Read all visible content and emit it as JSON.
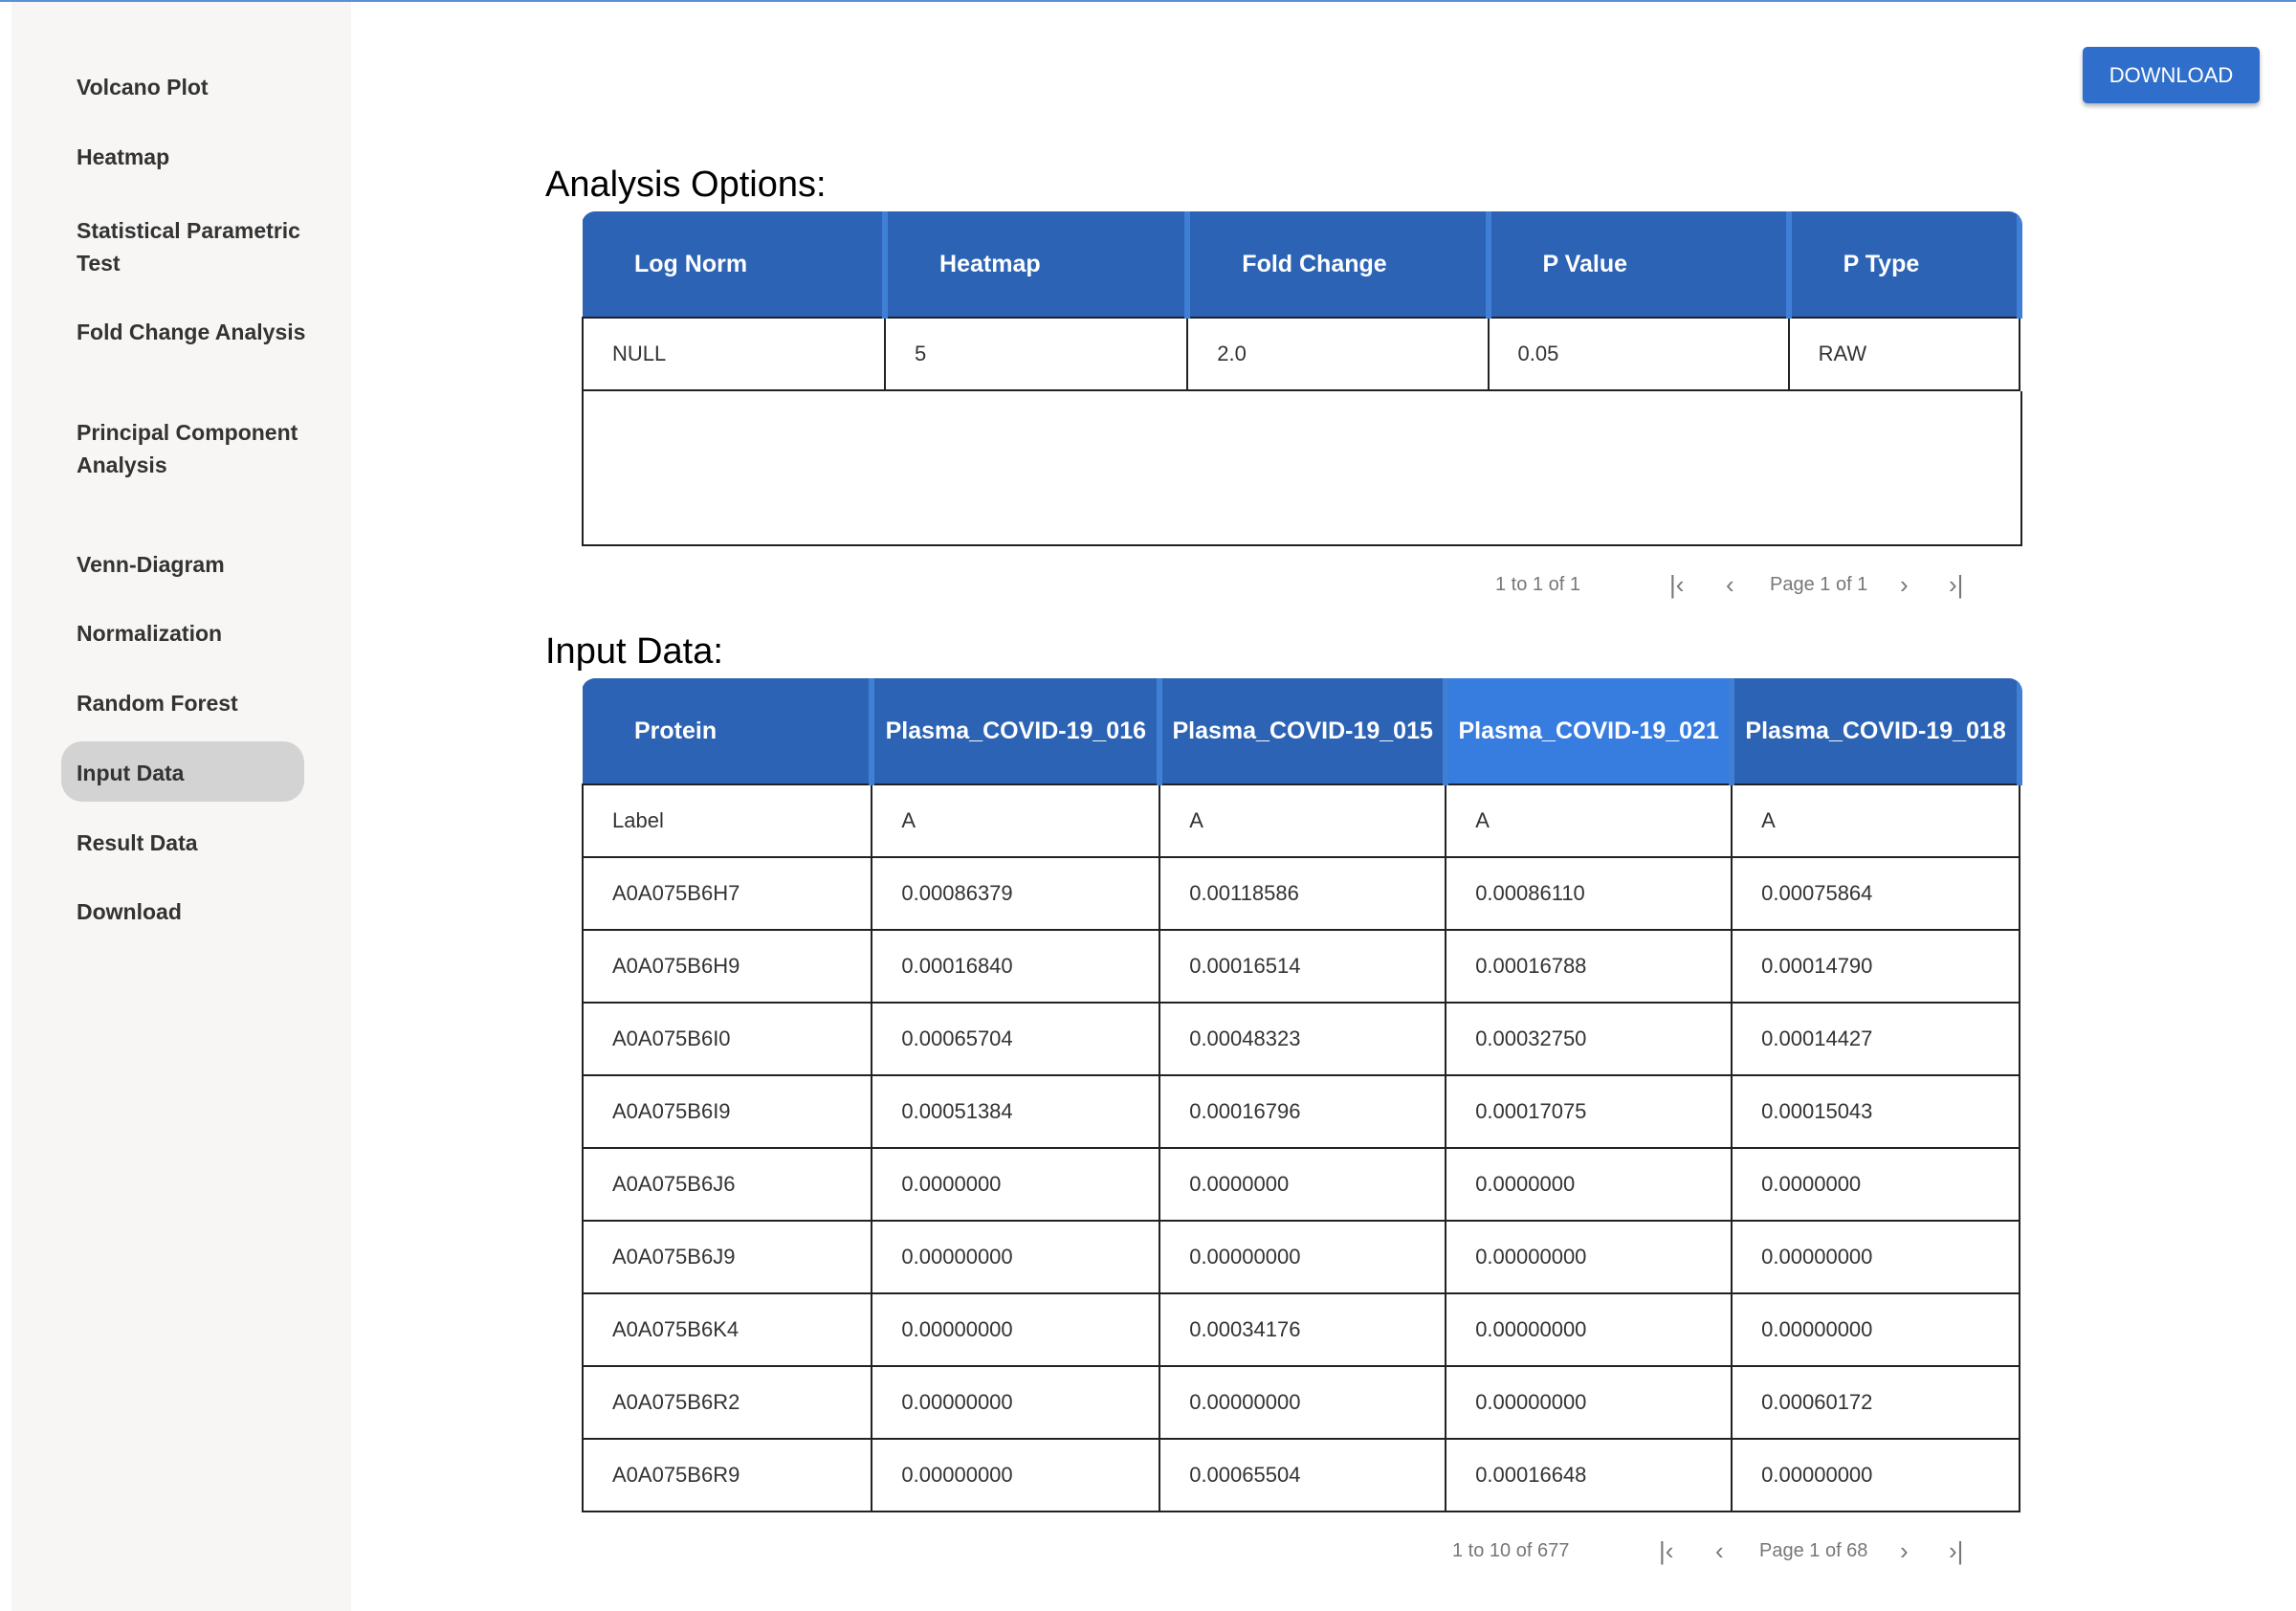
{
  "sidebar": {
    "items": [
      "Volcano Plot",
      "Heatmap",
      "Statistical Parametric Test",
      "Fold Change Analysis",
      "Principal Component Analysis",
      "Venn-Diagram",
      "Normalization",
      "Random Forest",
      "Input Data",
      "Result Data",
      "Download"
    ],
    "active": "Input Data"
  },
  "download_button": "DOWNLOAD",
  "analysis": {
    "title": "Analysis Options:",
    "headers": [
      "Log Norm",
      "Heatmap",
      "Fold Change",
      "P Value",
      "P Type"
    ],
    "rows": [
      [
        "NULL",
        "5",
        "2.0",
        "0.05",
        "RAW"
      ]
    ],
    "pager": {
      "summary": "1 to 1 of 1",
      "page": "Page 1 of 1"
    }
  },
  "input": {
    "title": "Input Data:",
    "headers": [
      "Protein",
      "Plasma_COVID-19_016",
      "Plasma_COVID-19_015",
      "Plasma_COVID-19_021",
      "Plasma_COVID-19_018"
    ],
    "rows": [
      [
        "Label",
        "A",
        "A",
        "A",
        "A"
      ],
      [
        "A0A075B6H7",
        "0.00086379",
        "0.00118586",
        "0.00086110",
        "0.00075864"
      ],
      [
        "A0A075B6H9",
        "0.00016840",
        "0.00016514",
        "0.00016788",
        "0.00014790"
      ],
      [
        "A0A075B6I0",
        "0.00065704",
        "0.00048323",
        "0.00032750",
        "0.00014427"
      ],
      [
        "A0A075B6I9",
        "0.00051384",
        "0.00016796",
        "0.00017075",
        "0.00015043"
      ],
      [
        "A0A075B6J6",
        "0.0000000",
        "0.0000000",
        "0.0000000",
        "0.0000000"
      ],
      [
        "A0A075B6J9",
        "0.00000000",
        "0.00000000",
        "0.00000000",
        "0.00000000"
      ],
      [
        "A0A075B6K4",
        "0.00000000",
        "0.00034176",
        "0.00000000",
        "0.00000000"
      ],
      [
        "A0A075B6R2",
        "0.00000000",
        "0.00000000",
        "0.00000000",
        "0.00060172"
      ],
      [
        "A0A075B6R9",
        "0.00000000",
        "0.00065504",
        "0.00016648",
        "0.00000000"
      ]
    ],
    "pager": {
      "summary": "1 to 10 of 677",
      "page": "Page 1 of 68"
    }
  },
  "colors": {
    "header": "#2c63b4",
    "header_highlight": "#377ddf",
    "button": "#2f6fcb"
  }
}
